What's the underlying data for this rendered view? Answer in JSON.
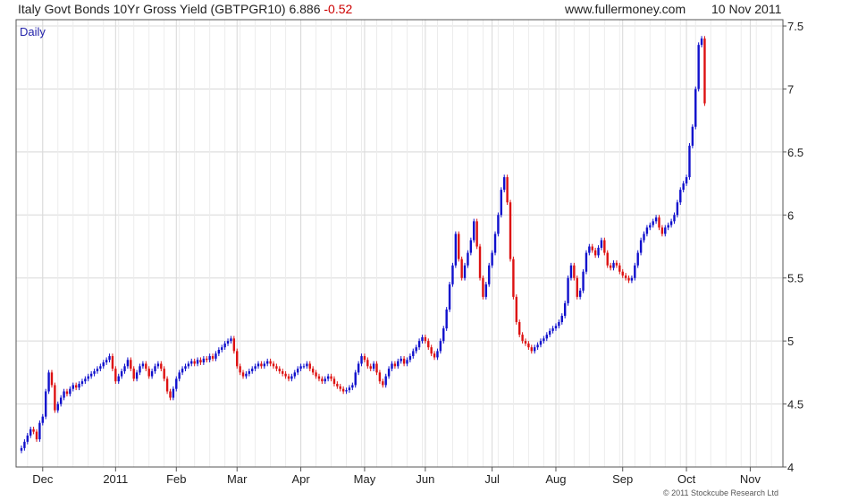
{
  "header": {
    "title": "Italy Govt Bonds 10Yr Gross Yield (GBTPGR10)",
    "last": "6.886",
    "change": "-0.52",
    "site": "www.fullermoney.com",
    "date": "10 Nov 2011"
  },
  "period_label": "Daily",
  "copyright": "© 2011 Stockcube Research Ltd",
  "colors": {
    "up": "#1010cc",
    "down": "#dd1111",
    "grid": "#d8d8d8",
    "axis": "#555555"
  },
  "chart_data": {
    "type": "line",
    "title": "Italy Govt Bonds 10Yr Gross Yield (GBTPGR10)",
    "xlabel": "",
    "ylabel": "",
    "ylim": [
      4,
      7.55
    ],
    "yticks": [
      4,
      4.5,
      5,
      5.5,
      6,
      6.5,
      7,
      7.5
    ],
    "ytick_labels": [
      "4",
      "4.5",
      "5",
      "5.5",
      "6",
      "6.5",
      "7",
      "7.5"
    ],
    "xtick_labels": [
      "Dec",
      "2011",
      "Feb",
      "Mar",
      "Apr",
      "May",
      "Jun",
      "Jul",
      "Aug",
      "Sep",
      "Oct",
      "Nov"
    ],
    "xtick_positions": [
      7,
      31,
      51,
      71,
      92,
      113,
      133,
      155,
      176,
      198,
      219,
      240
    ],
    "x_range": [
      0,
      249
    ],
    "grid": true,
    "series": [
      {
        "values": [
          4.15,
          4.2,
          4.25,
          4.3,
          4.28,
          4.22,
          4.35,
          4.4,
          4.6,
          4.75,
          4.65,
          4.45,
          4.5,
          4.55,
          4.6,
          4.58,
          4.62,
          4.65,
          4.63,
          4.66,
          4.68,
          4.7,
          4.72,
          4.74,
          4.76,
          4.78,
          4.8,
          4.83,
          4.85,
          4.88,
          4.78,
          4.68,
          4.72,
          4.76,
          4.8,
          4.85,
          4.78,
          4.7,
          4.75,
          4.8,
          4.82,
          4.78,
          4.72,
          4.76,
          4.8,
          4.82,
          4.78,
          4.7,
          4.6,
          4.55,
          4.62,
          4.7,
          4.75,
          4.78,
          4.8,
          4.82,
          4.84,
          4.82,
          4.85,
          4.83,
          4.86,
          4.85,
          4.88,
          4.86,
          4.9,
          4.93,
          4.95,
          4.98,
          5.0,
          5.02,
          4.92,
          4.8,
          4.75,
          4.72,
          4.74,
          4.76,
          4.78,
          4.8,
          4.82,
          4.8,
          4.82,
          4.84,
          4.82,
          4.8,
          4.78,
          4.76,
          4.74,
          4.72,
          4.7,
          4.72,
          4.75,
          4.78,
          4.8,
          4.8,
          4.82,
          4.78,
          4.75,
          4.72,
          4.7,
          4.68,
          4.7,
          4.72,
          4.7,
          4.66,
          4.64,
          4.62,
          4.6,
          4.61,
          4.63,
          4.65,
          4.75,
          4.82,
          4.88,
          4.85,
          4.8,
          4.78,
          4.82,
          4.75,
          4.68,
          4.65,
          4.72,
          4.78,
          4.82,
          4.8,
          4.84,
          4.86,
          4.82,
          4.85,
          4.88,
          4.92,
          4.95,
          5.0,
          5.03,
          5.0,
          4.95,
          4.9,
          4.87,
          4.92,
          5.0,
          5.1,
          5.25,
          5.45,
          5.6,
          5.85,
          5.65,
          5.5,
          5.6,
          5.7,
          5.8,
          5.95,
          5.75,
          5.5,
          5.35,
          5.45,
          5.6,
          5.7,
          5.85,
          6.0,
          6.2,
          6.3,
          6.1,
          5.65,
          5.35,
          5.15,
          5.05,
          5.0,
          4.98,
          4.95,
          4.92,
          4.95,
          4.97,
          5.0,
          5.02,
          5.05,
          5.08,
          5.1,
          5.12,
          5.15,
          5.2,
          5.3,
          5.5,
          5.6,
          5.5,
          5.35,
          5.4,
          5.55,
          5.7,
          5.75,
          5.72,
          5.68,
          5.74,
          5.8,
          5.7,
          5.6,
          5.58,
          5.62,
          5.6,
          5.55,
          5.52,
          5.5,
          5.48,
          5.5,
          5.6,
          5.7,
          5.8,
          5.85,
          5.9,
          5.92,
          5.95,
          5.98,
          5.9,
          5.85,
          5.9,
          5.92,
          5.95,
          6.0,
          6.1,
          6.2,
          6.25,
          6.3,
          6.55,
          6.7,
          7.0,
          7.35,
          7.4,
          6.886
        ]
      }
    ]
  }
}
